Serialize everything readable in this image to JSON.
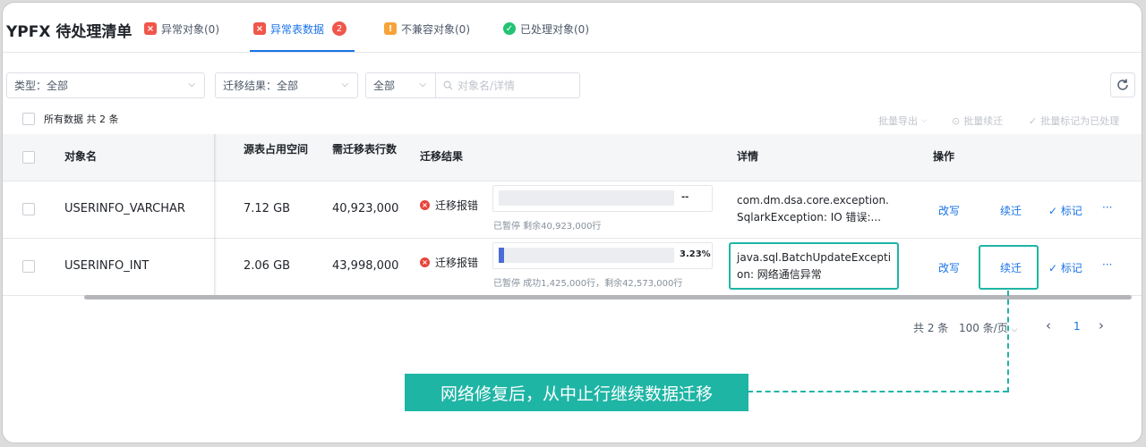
{
  "header": {
    "title": "YPFX 待处理清单",
    "tabs": [
      {
        "label": "异常对象(0)",
        "active": false,
        "icon": "error-icon",
        "color": "#f0564b"
      },
      {
        "label": "异常表数据",
        "active": true,
        "icon": "error-table-icon",
        "color": "#f0564b",
        "badge": "2"
      },
      {
        "label": "不兼容对象(0)",
        "active": false,
        "icon": "warning-icon",
        "color": "#f7a33a"
      },
      {
        "label": "已处理对象(0)",
        "active": false,
        "icon": "check-circle-icon",
        "color": "#23c373"
      }
    ]
  },
  "filters": {
    "type_select": "类型：全部",
    "result_select": "迁移结果：全部",
    "scope_select": "全部",
    "search_placeholder": "对象名/详情"
  },
  "toolbar": {
    "all_data_label": "所有数据 共 2 条",
    "batch_export": "批量导出",
    "batch_resume": "批量续迁",
    "batch_mark": "批量标记为已处理"
  },
  "table": {
    "headers": {
      "name": "对象名",
      "space": "源表占用空间",
      "rows": "需迁移表行数",
      "result": "迁移结果",
      "detail": "详情",
      "ops": "操作"
    },
    "rows": [
      {
        "name": "USERINFO_VARCHAR",
        "space": "7.12 GB",
        "rows": "40,923,000",
        "status": "迁移报错",
        "progress_text": "--",
        "progress_value": 0,
        "progress_sub": "已暂停 剩余40,923,000行",
        "detail_line1": "com.dm.dsa.core.exception.",
        "detail_line2": "SqlarkException: IO 错误:...",
        "op_rewrite": "改写",
        "op_resume": "续迁",
        "op_mark": "标记",
        "op_more": "···"
      },
      {
        "name": "USERINFO_INT",
        "space": "2.06 GB",
        "rows": "43,998,000",
        "status": "迁移报错",
        "progress_text": "3.23%",
        "progress_value": 3.23,
        "progress_sub": "已暂停 成功1,425,000行，剩余42,573,000行",
        "detail_line1": "java.sql.BatchUpdateExcepti",
        "detail_line2": "on: 网络通信异常",
        "op_rewrite": "改写",
        "op_resume": "续迁",
        "op_mark": "标记",
        "op_more": "···"
      }
    ]
  },
  "pagination": {
    "total": "共 2 条",
    "page_size": "100 条/页",
    "current_page": "1"
  },
  "callout": {
    "text": "网络修复后，从中止行继续数据迁移",
    "color": "#1fb5a5"
  }
}
